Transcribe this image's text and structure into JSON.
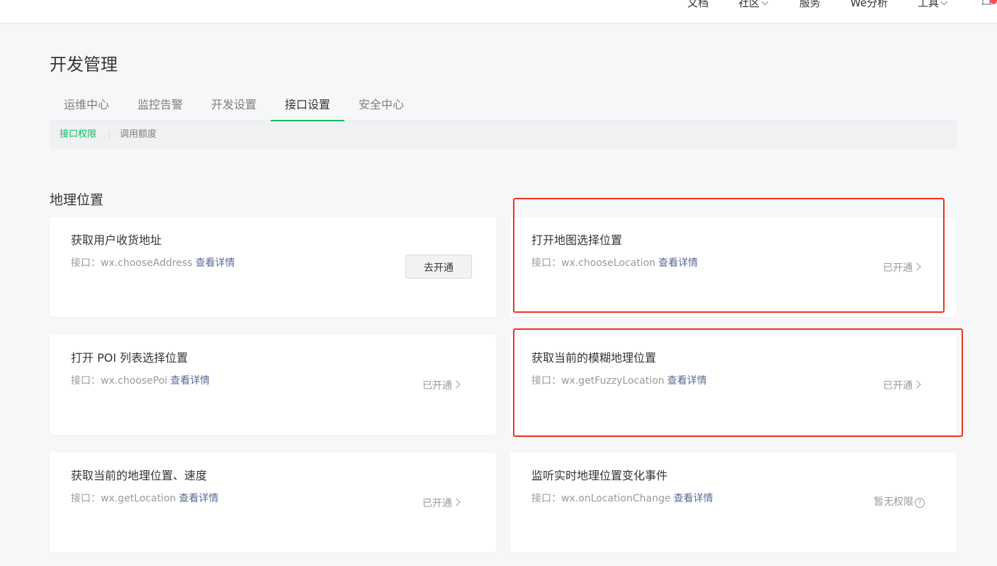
{
  "topnav": {
    "items": [
      {
        "label": "文档",
        "dropdown": false
      },
      {
        "label": "社区",
        "dropdown": true
      },
      {
        "label": "服务",
        "dropdown": false
      },
      {
        "label": "We分析",
        "dropdown": false
      },
      {
        "label": "工具",
        "dropdown": true
      }
    ]
  },
  "page": {
    "title": "开发管理"
  },
  "tabs": [
    {
      "label": "运维中心",
      "active": false
    },
    {
      "label": "监控告警",
      "active": false
    },
    {
      "label": "开发设置",
      "active": false
    },
    {
      "label": "接口设置",
      "active": true
    },
    {
      "label": "安全中心",
      "active": false
    }
  ],
  "subtabs": [
    {
      "label": "接口权限",
      "active": true
    },
    {
      "label": "调用额度",
      "active": false
    }
  ],
  "section": {
    "title": "地理位置"
  },
  "common": {
    "api_prefix": "接口：",
    "detail_link": "查看详情"
  },
  "cards": [
    {
      "title": "获取用户收货地址",
      "api": "wx.chooseAddress",
      "action": "button",
      "action_label": "去开通"
    },
    {
      "title": "打开地图选择位置",
      "api": "wx.chooseLocation",
      "action": "status",
      "action_label": "已开通"
    },
    {
      "title": "打开 POI 列表选择位置",
      "api": "wx.choosePoi",
      "action": "status",
      "action_label": "已开通"
    },
    {
      "title": "获取当前的模糊地理位置",
      "api": "wx.getFuzzyLocation",
      "action": "status",
      "action_label": "已开通"
    },
    {
      "title": "获取当前的地理位置、速度",
      "api": "wx.getLocation",
      "action": "status",
      "action_label": "已开通"
    },
    {
      "title": "监听实时地理位置变化事件",
      "api": "wx.onLocationChange",
      "action": "no-permission",
      "action_label": "暂无权限"
    }
  ],
  "colors": {
    "accent": "#07c160",
    "link": "#576b95",
    "highlight": "#f4301c",
    "notification": "#fa5151"
  }
}
